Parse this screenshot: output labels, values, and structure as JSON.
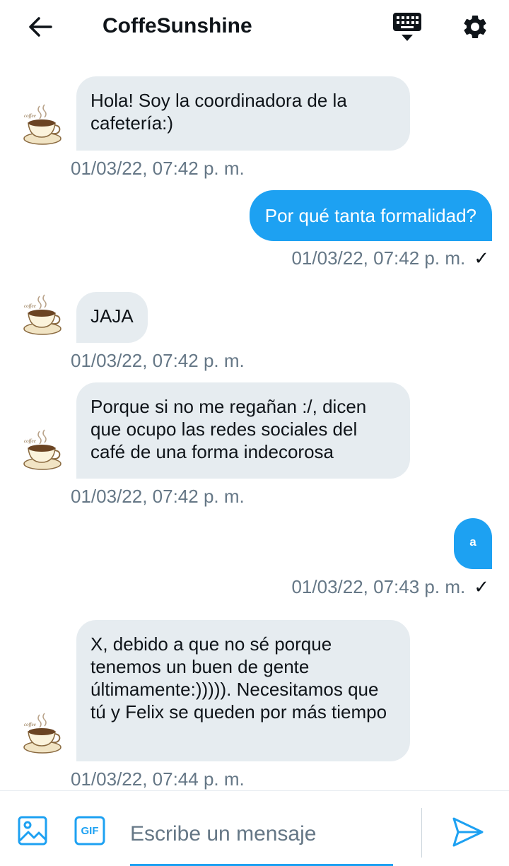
{
  "header": {
    "title": "CoffeSunshine",
    "back_icon": "arrow-left-icon",
    "keyboard_icon": "keyboard-icon",
    "settings_icon": "gear-icon"
  },
  "messages": [
    {
      "direction": "in",
      "text": "Hola! Soy la coordinadora de la cafetería:)",
      "timestamp": "01/03/22, 07:42 p. m."
    },
    {
      "direction": "out",
      "text": "Por qué tanta formalidad?",
      "timestamp": "01/03/22, 07:42 p. m.",
      "status": "✓"
    },
    {
      "direction": "in",
      "text": "JAJA",
      "timestamp": "01/03/22, 07:42 p. m."
    },
    {
      "direction": "in",
      "text": "Porque si no me regañan :/, dicen que ocupo las redes sociales del café de una forma indecorosa",
      "timestamp": "01/03/22, 07:42 p. m."
    },
    {
      "direction": "out",
      "text": "a",
      "timestamp": "01/03/22, 07:43 p. m.",
      "status": "✓"
    },
    {
      "direction": "in",
      "text": "X, debido a que no sé porque tenemos un buen de gente últimamente:))))). Necesitamos que tú y Felix se queden por más tiempo",
      "timestamp": "01/03/22, 07:44 p. m."
    }
  ],
  "composer": {
    "placeholder": "Escribe un mensaje",
    "value": "",
    "image_icon": "image-icon",
    "gif_label": "GIF",
    "send_icon": "send-icon"
  },
  "colors": {
    "accent": "#1da1f2",
    "bubble_in": "#e6ecf0",
    "text": "#0f1419",
    "muted": "#657786"
  }
}
